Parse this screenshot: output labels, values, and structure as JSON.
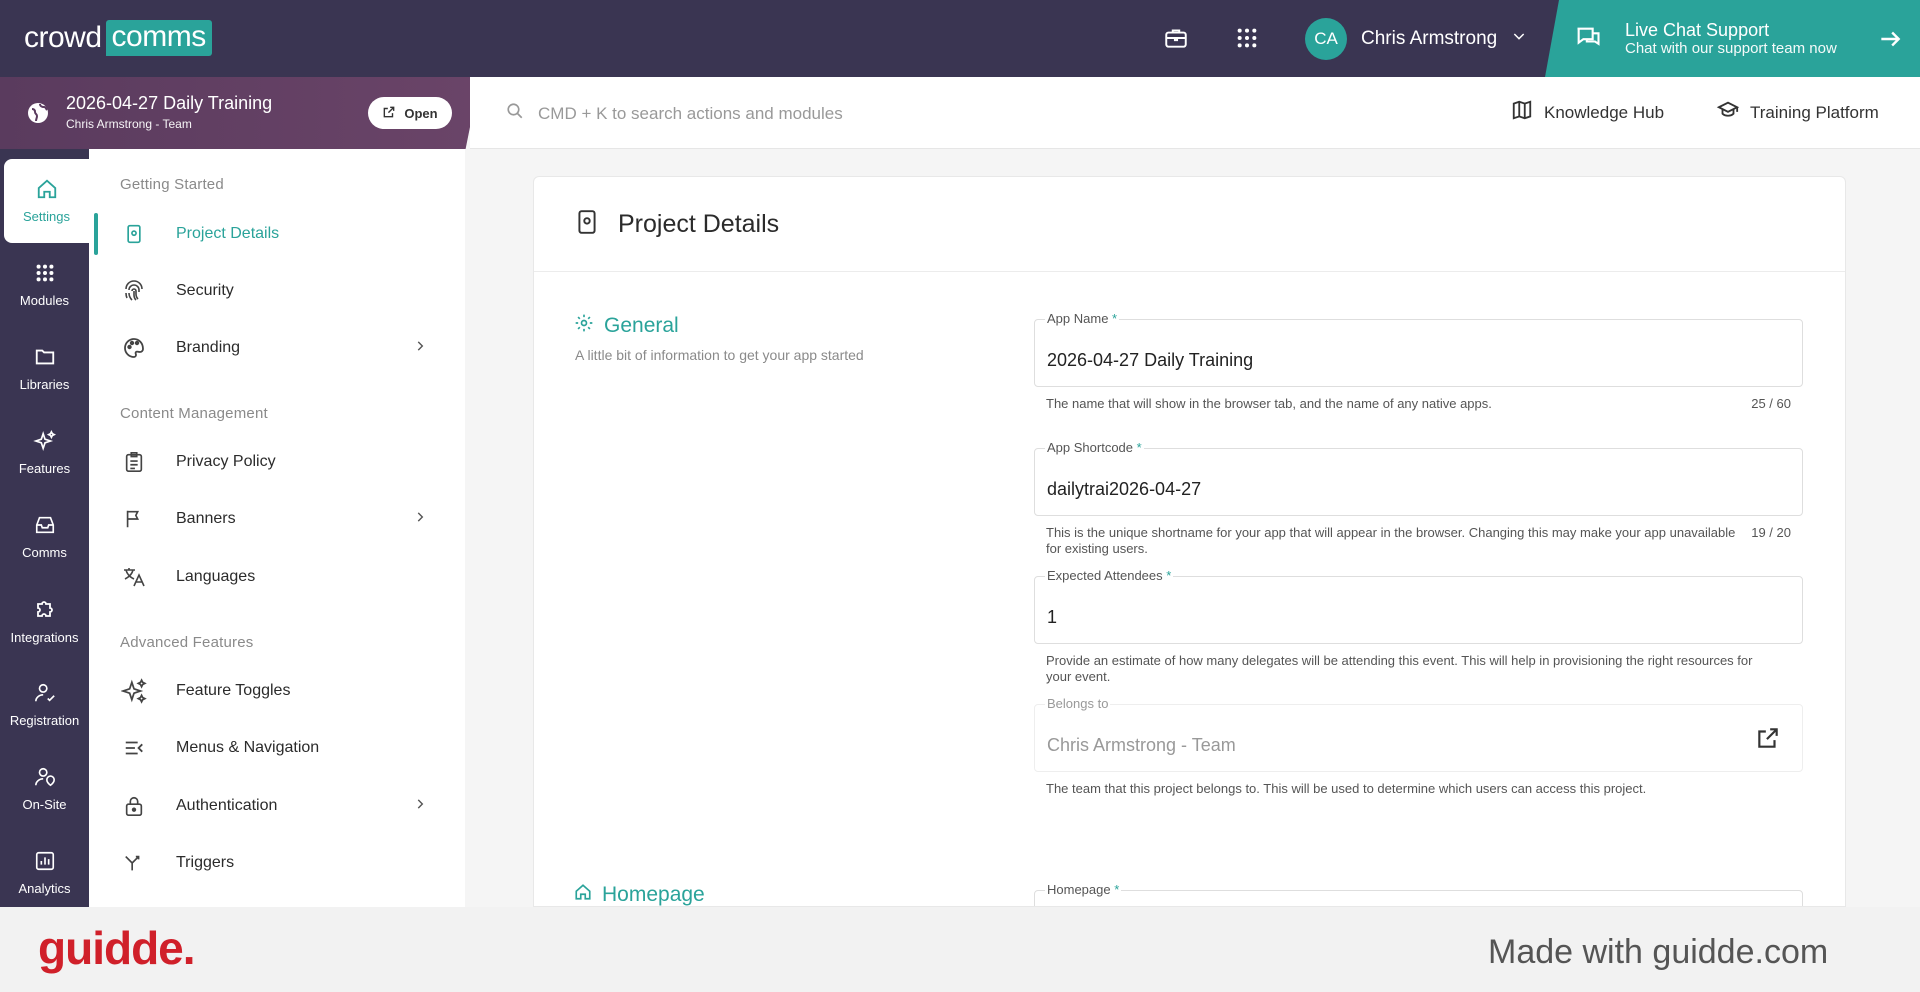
{
  "topbar": {
    "logo_left": "crowd",
    "logo_right": "comms",
    "user_initials": "CA",
    "user_name": "Chris Armstrong",
    "live_chat_title": "Live Chat Support",
    "live_chat_sub": "Chat with our support team now"
  },
  "project": {
    "title": "2026-04-27 Daily Training",
    "subtitle": "Chris Armstrong - Team",
    "open_label": "Open"
  },
  "search": {
    "placeholder": "CMD + K to search actions and modules"
  },
  "links": {
    "knowledge_hub": "Knowledge Hub",
    "training_platform": "Training Platform"
  },
  "leftnav": [
    {
      "label": "Settings",
      "icon": "home-icon"
    },
    {
      "label": "Modules",
      "icon": "grid-icon"
    },
    {
      "label": "Libraries",
      "icon": "folder-icon"
    },
    {
      "label": "Features",
      "icon": "sparkle-icon"
    },
    {
      "label": "Comms",
      "icon": "inbox-icon"
    },
    {
      "label": "Integrations",
      "icon": "puzzle-icon"
    },
    {
      "label": "Registration",
      "icon": "user-check-icon"
    },
    {
      "label": "On-Site",
      "icon": "user-location-icon"
    },
    {
      "label": "Analytics",
      "icon": "chart-icon"
    }
  ],
  "submenu": {
    "getting_started": "Getting Started",
    "content_management": "Content Management",
    "advanced_features": "Advanced Features",
    "items": [
      "Project Details",
      "Security",
      "Branding",
      "Privacy Policy",
      "Banners",
      "Languages",
      "Feature Toggles",
      "Menus & Navigation",
      "Authentication",
      "Triggers"
    ]
  },
  "main": {
    "title": "Project Details",
    "general_title": "General",
    "general_sub": "A little bit of information to get your app started",
    "homepage_title": "Homepage",
    "fields": {
      "app_name": {
        "label": "App Name",
        "value": "2026-04-27 Daily Training",
        "help": "The name that will show in the browser tab, and the name of any native apps.",
        "count": "25 / 60"
      },
      "shortcode": {
        "label": "App Shortcode",
        "value": "dailytrai2026-04-27",
        "help": "This is the unique shortname for your app that will appear in the browser. Changing this may make your app unavailable for existing users.",
        "count": "19 / 20"
      },
      "attendees": {
        "label": "Expected Attendees",
        "value": "1",
        "help": "Provide an estimate of how many delegates will be attending this event. This will help in provisioning the right resources for your event."
      },
      "belongs_to": {
        "label": "Belongs to",
        "value": "Chris Armstrong - Team",
        "help": "The team that this project belongs to. This will be used to determine which users can access this project."
      },
      "homepage": {
        "label": "Homepage"
      }
    },
    "required_mark": "*"
  },
  "footer": {
    "brand": "guidde.",
    "made_with": "Made with guidde.com"
  },
  "colors": {
    "accent": "#2aa39a",
    "nav": "#3a3552",
    "project": "#5a3b5e",
    "brand_red": "#d0202a"
  }
}
